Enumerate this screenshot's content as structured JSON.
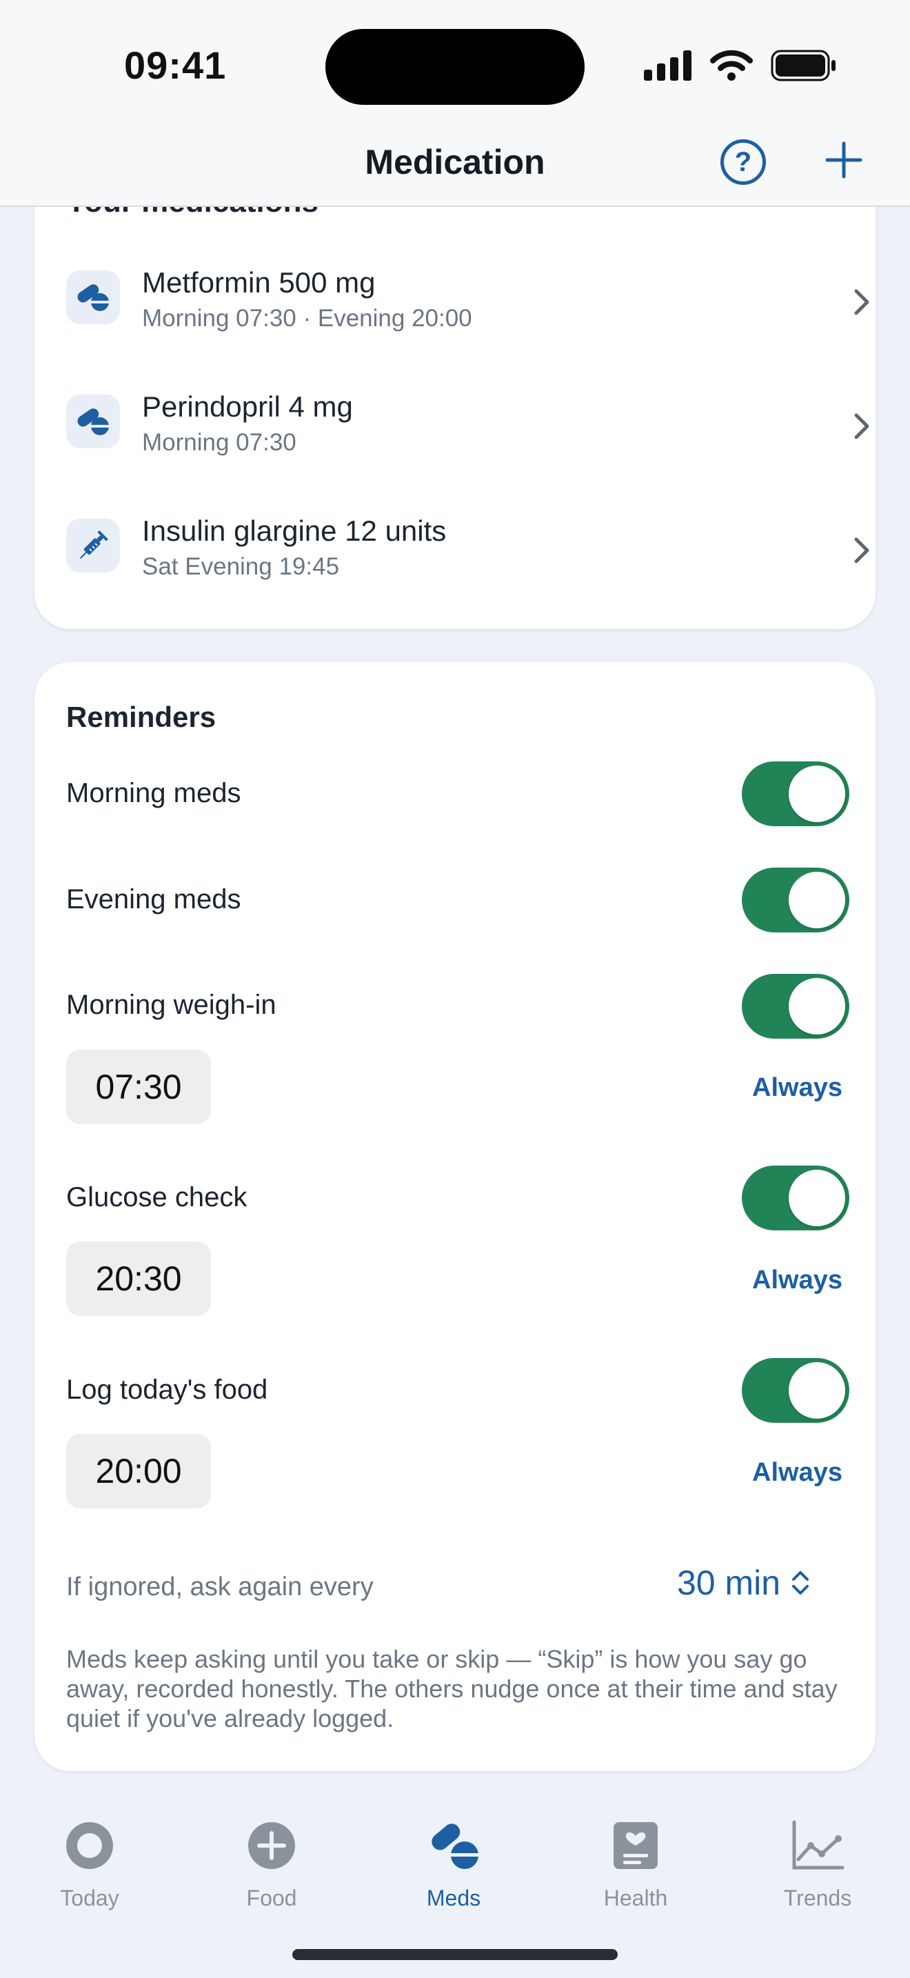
{
  "status_bar": {
    "time": "09:41"
  },
  "header": {
    "title": "Medication",
    "help_label": "?"
  },
  "medications": {
    "heading": "Your medications",
    "items": [
      {
        "name": "Metformin 500 mg",
        "schedule": "Morning 07:30 · Evening 20:00",
        "icon": "pill-icon"
      },
      {
        "name": "Perindopril 4 mg",
        "schedule": "Morning 07:30",
        "icon": "pill-icon"
      },
      {
        "name": "Insulin glargine 12 units",
        "schedule": "Sat Evening 19:45",
        "icon": "syringe-icon"
      }
    ]
  },
  "reminders": {
    "title": "Reminders",
    "items": [
      {
        "label": "Morning meds",
        "enabled": true
      },
      {
        "label": "Evening meds",
        "enabled": true
      },
      {
        "label": "Morning weigh-in",
        "enabled": true,
        "time": "07:30",
        "repeat": "Always"
      },
      {
        "label": "Glucose check",
        "enabled": true,
        "time": "20:30",
        "repeat": "Always"
      },
      {
        "label": "Log today's food",
        "enabled": true,
        "time": "20:00",
        "repeat": "Always"
      }
    ],
    "ignored_label": "If ignored, ask again every",
    "interval": "30 min",
    "footnote": "Meds keep asking until you take or skip — “Skip” is how you say go away, recorded honestly. The others nudge once at their time and stay quiet if you've already logged."
  },
  "tabbar": {
    "tabs": [
      {
        "label": "Today",
        "icon": "circle-icon",
        "active": false
      },
      {
        "label": "Food",
        "icon": "plus-circle-icon",
        "active": false
      },
      {
        "label": "Meds",
        "icon": "pill-icon",
        "active": true
      },
      {
        "label": "Health",
        "icon": "heart-clipboard-icon",
        "active": false
      },
      {
        "label": "Trends",
        "icon": "line-chart-icon",
        "active": false
      }
    ]
  },
  "colors": {
    "accent": "#1d5fa3",
    "toggle_on": "#218456",
    "background": "#eef2f8"
  }
}
